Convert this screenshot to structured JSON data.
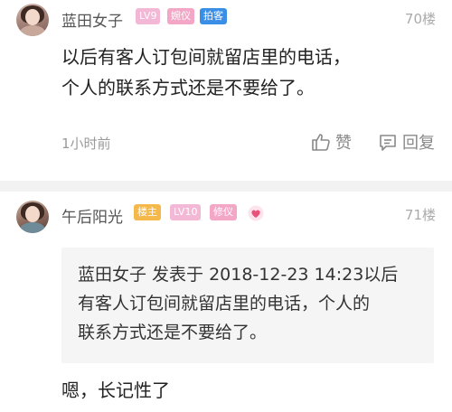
{
  "posts": [
    {
      "username": "蓝田女子",
      "badges": [
        "LV9",
        "婉仪",
        "拍客"
      ],
      "floor": "70楼",
      "text_lines": [
        "以后有客人订包间就留店里的电话，",
        "个人的联系方式还是不要给了。"
      ],
      "time": "1小时前",
      "like_label": "赞",
      "reply_label": "回复"
    },
    {
      "username": "午后阳光",
      "badges": [
        "楼主",
        "LV10",
        "修仪"
      ],
      "floor": "71楼",
      "quote_lines": [
        "蓝田女子 发表于 2018-12-23 14:23以后",
        "有客人订包间就留店里的电话，个人的",
        "联系方式还是不要给了。"
      ],
      "text": "嗯，长记性了"
    }
  ],
  "colors": {
    "badge_level_bg": "#f2b8d6",
    "badge_title_bg": "#f3a6c6",
    "badge_pai_bg": "#3b8ee6",
    "badge_host_bg": "#f5b84a",
    "heart": "#e8527a"
  },
  "icons": [
    "thumb-up-icon",
    "comment-icon",
    "heart-icon"
  ]
}
